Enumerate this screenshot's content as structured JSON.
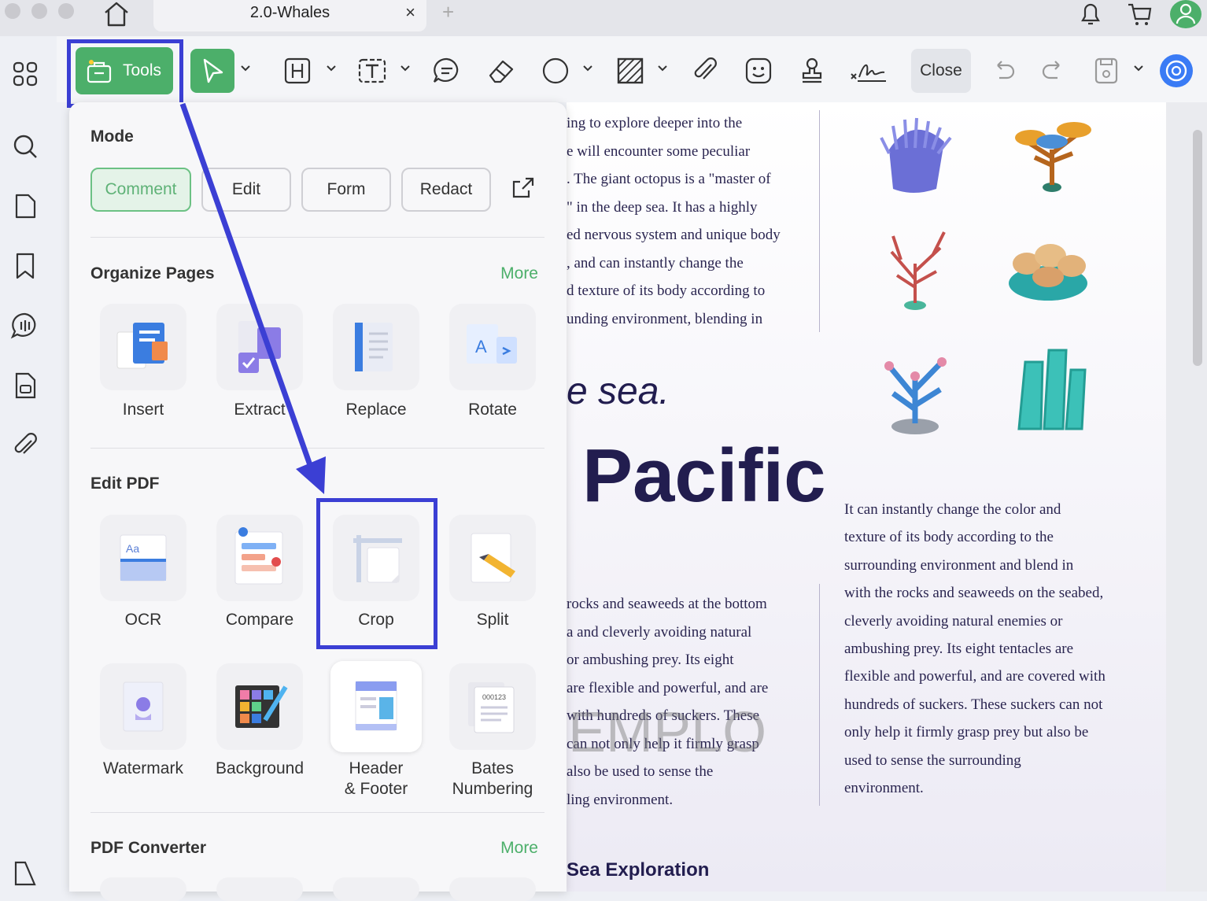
{
  "window": {
    "tab_title": "2.0-Whales",
    "tab_close": "×",
    "tab_add": "+"
  },
  "toolbar": {
    "tools_label": "Tools",
    "close_label": "Close"
  },
  "panel": {
    "mode_title": "Mode",
    "modes": [
      "Comment",
      "Edit",
      "Form",
      "Redact"
    ],
    "organize": {
      "title": "Organize Pages",
      "more": "More",
      "items": [
        "Insert",
        "Extract",
        "Replace",
        "Rotate"
      ]
    },
    "edit_pdf": {
      "title": "Edit PDF",
      "items": [
        "OCR",
        "Compare",
        "Crop",
        "Split",
        "Watermark",
        "Background",
        "Header\n& Footer",
        "Bates\nNumbering"
      ]
    },
    "converter": {
      "title": "PDF Converter",
      "more": "More"
    }
  },
  "document": {
    "col1_top": [
      "ing to explore deeper into the",
      "e will encounter some peculiar",
      ". The giant octopus is a \"master of",
      "\" in the deep sea. It has a highly",
      "ed nervous system and unique body",
      ", and can instantly change the",
      "d texture of its body according to",
      "unding environment, blending in"
    ],
    "heading_sea": "e sea.",
    "heading_pacific": "Pacific",
    "col1_bottom": [
      "rocks and seaweeds at the bottom",
      "a and cleverly avoiding natural",
      "or ambushing prey. Its eight",
      " are flexible and powerful, and are",
      "with hundreds of suckers. These",
      "can not only help it firmly grasp",
      "also be used to sense the",
      "ling environment."
    ],
    "col2": [
      "It can instantly change the color and",
      "texture of its body according to the",
      "surrounding environment and blend in",
      "with the rocks and seaweeds on the seabed,",
      "cleverly avoiding natural enemies or",
      "ambushing prey. Its eight tentacles are",
      "flexible and powerful, and are covered with",
      "hundreds of suckers. These suckers can not",
      "only help it firmly grasp prey but also be",
      "used to sense the surrounding",
      "environment."
    ],
    "watermark": "EMPLO",
    "subheading": "Sea Exploration"
  },
  "colors": {
    "accent": "#4caf6a",
    "highlight": "#3b3fd4",
    "doc_text": "#221d4f"
  }
}
